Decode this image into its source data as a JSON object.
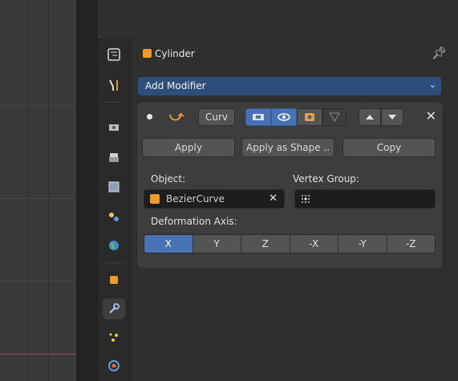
{
  "header": {
    "object_name": "Cylinder"
  },
  "add_modifier": {
    "label": "Add Modifier"
  },
  "modifier": {
    "name": "Curv",
    "buttons": {
      "apply": "Apply",
      "apply_shape": "Apply as Shape ..",
      "copy": "Copy"
    },
    "object_label": "Object:",
    "object_value": "BezierCurve",
    "vertex_group_label": "Vertex Group:",
    "deformation_axis_label": "Deformation Axis:",
    "axes": [
      "X",
      "Y",
      "Z",
      "-X",
      "-Y",
      "-Z"
    ],
    "selected_axis": "X"
  },
  "colors": {
    "accent": "#4772b3",
    "object_orange": "#f09a2a",
    "dropdown_blue": "#2e4f7c"
  }
}
